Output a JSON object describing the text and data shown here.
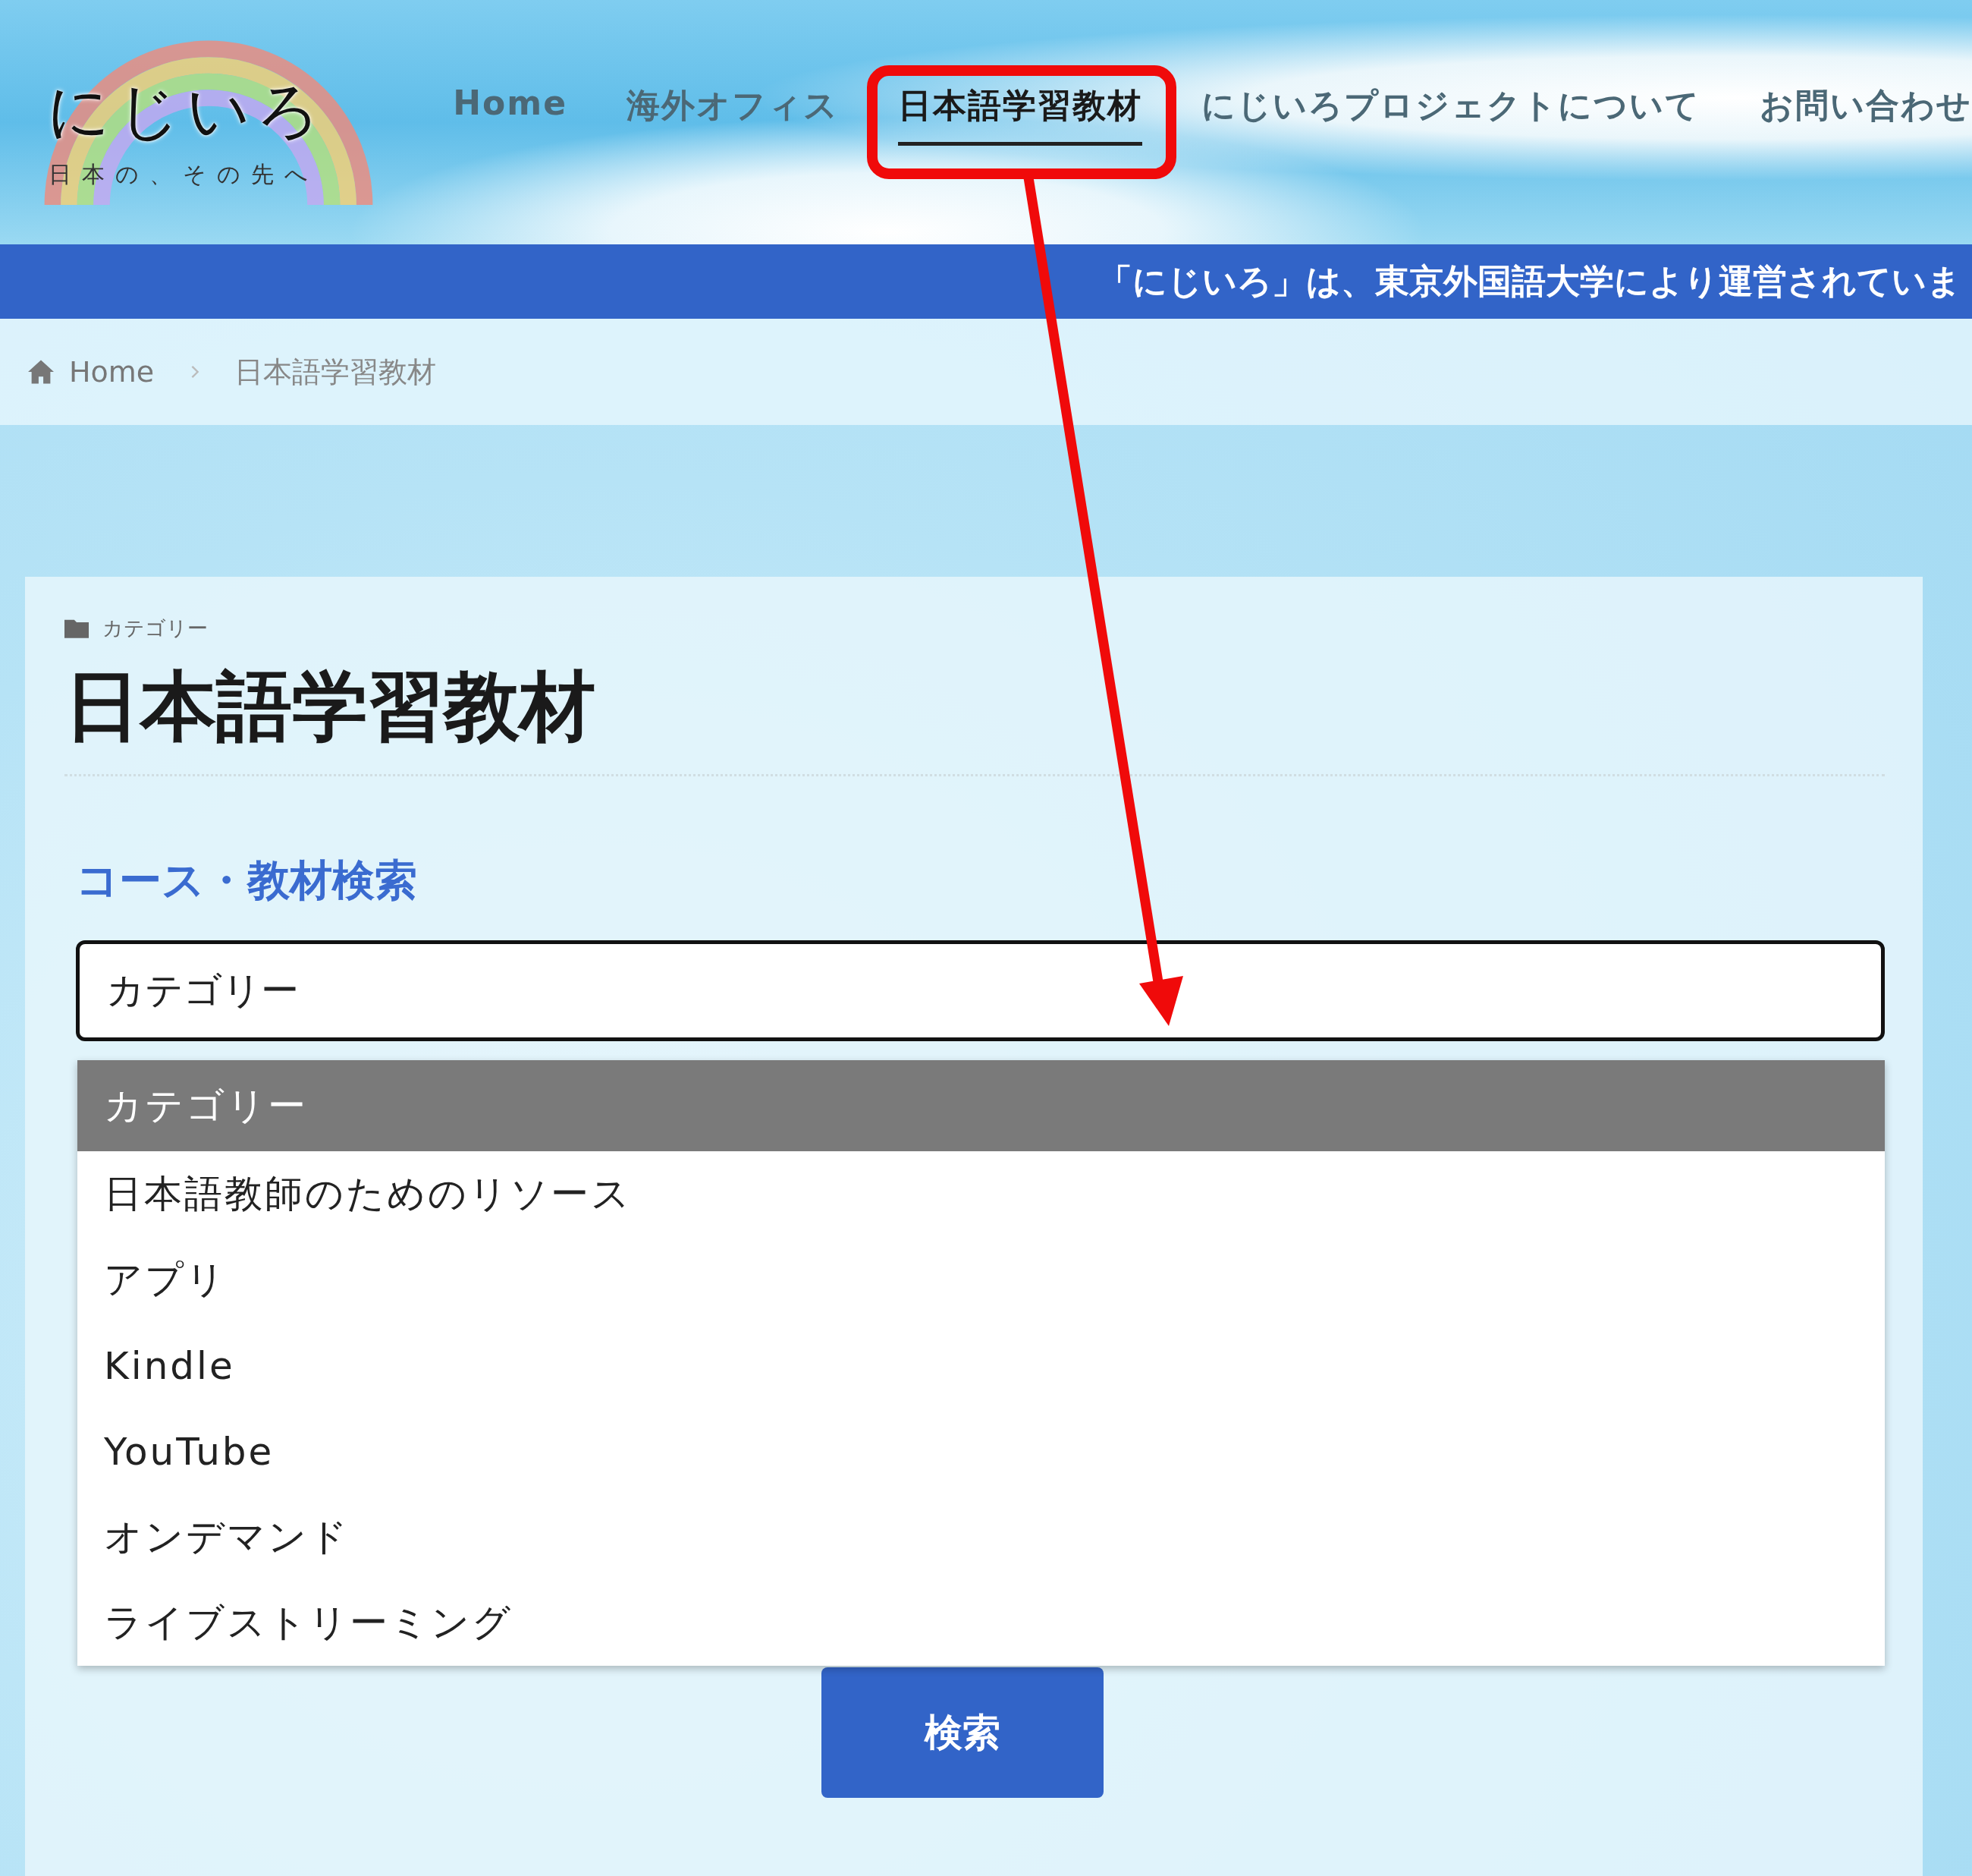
{
  "logo": {
    "title": "にじいろ",
    "tagline": "日本の、その先へ"
  },
  "nav": [
    {
      "label": "Home",
      "selected": false
    },
    {
      "label": "海外オフィス",
      "selected": false
    },
    {
      "label": "日本語学習教材",
      "selected": true
    },
    {
      "label": "にじいろプロジェクトについて",
      "selected": false
    },
    {
      "label": "お問い合わせ",
      "selected": false
    }
  ],
  "banner": {
    "text": "「にじいろ」は、東京外国語大学により運営されていま"
  },
  "breadcrumb": [
    {
      "label": "Home"
    },
    {
      "label": "日本語学習教材"
    }
  ],
  "card": {
    "category_label": "カテゴリー",
    "title": "日本語学習教材",
    "search_heading": "コース・教材検索",
    "select": {
      "value": "カテゴリー",
      "expanded": true,
      "options": [
        {
          "label": "カテゴリー",
          "selected": true
        },
        {
          "label": "日本語教師のためのリソース",
          "selected": false
        },
        {
          "label": "アプリ",
          "selected": false
        },
        {
          "label": "Kindle",
          "selected": false
        },
        {
          "label": "YouTube",
          "selected": false
        },
        {
          "label": "オンデマンド",
          "selected": false
        },
        {
          "label": "ライブストリーミング",
          "selected": false
        }
      ]
    },
    "search_button": "検索"
  }
}
